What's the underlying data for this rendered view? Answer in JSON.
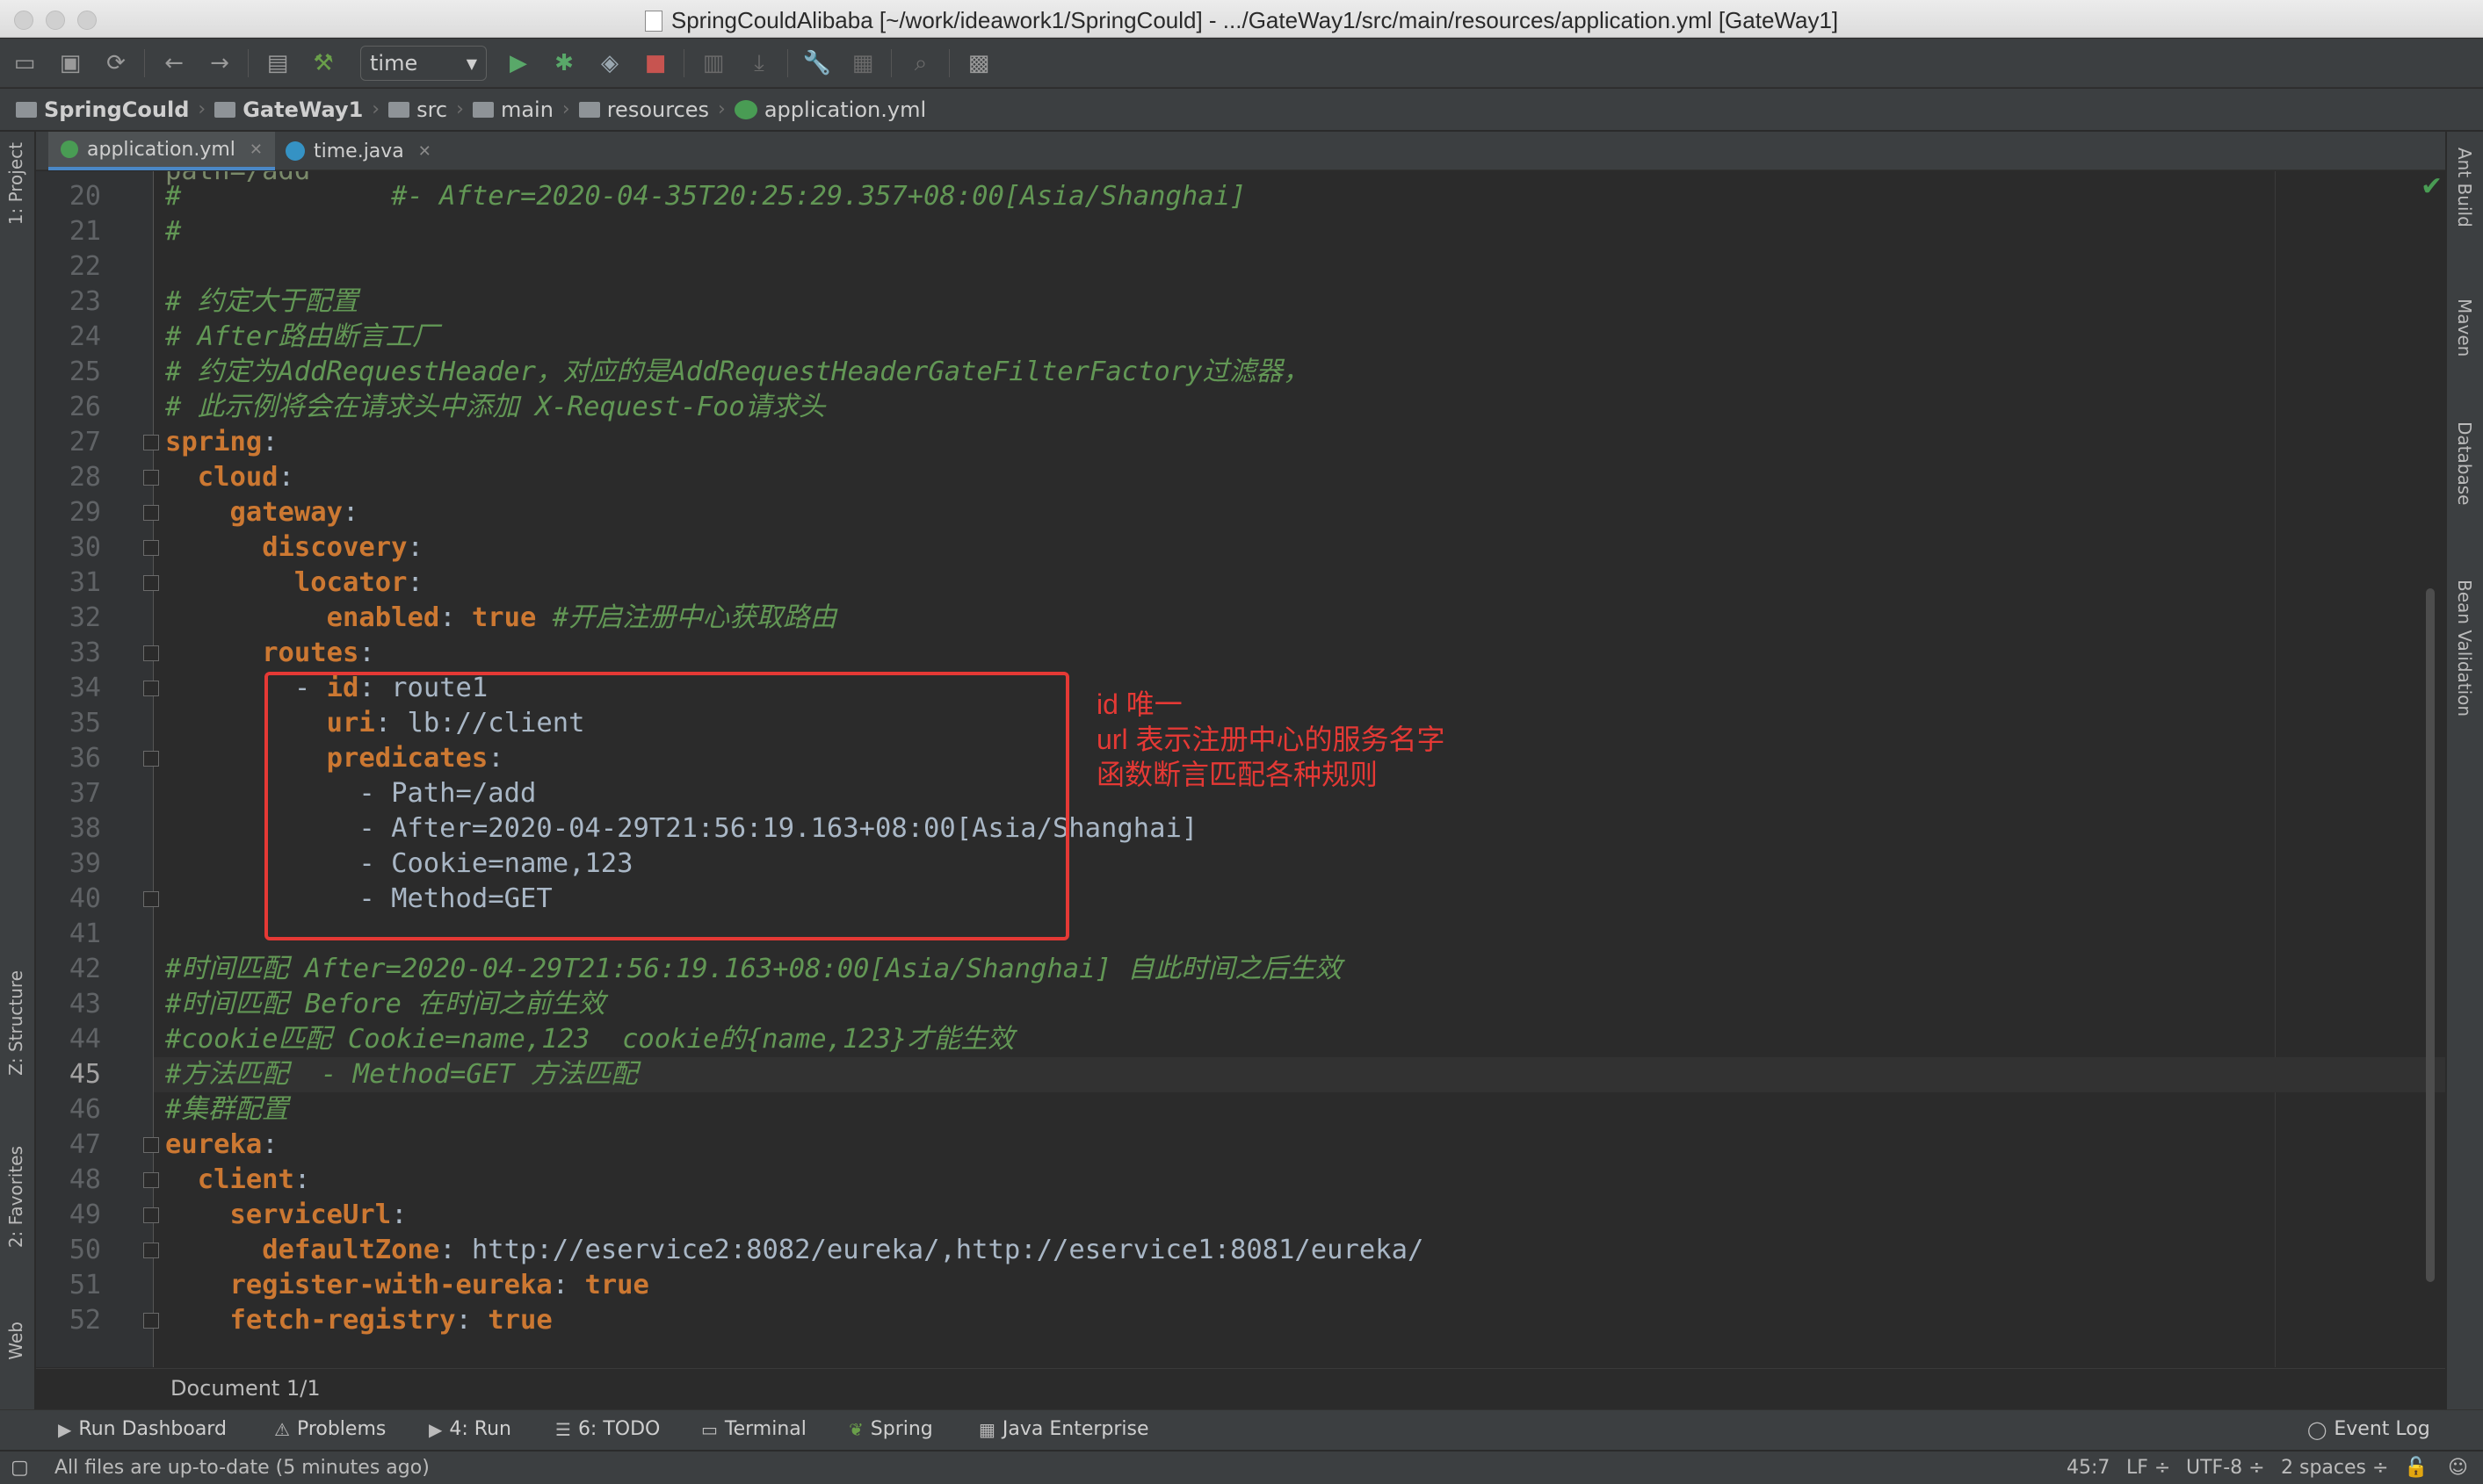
{
  "window": {
    "title": "SpringCouldAlibaba [~/work/ideawork1/SpringCould] - .../GateWay1/src/main/resources/application.yml [GateWay1]"
  },
  "toolbar": {
    "run_config": "time"
  },
  "breadcrumb": [
    "SpringCould",
    "GateWay1",
    "src",
    "main",
    "resources",
    "application.yml"
  ],
  "tabs": [
    {
      "label": "application.yml",
      "active": true
    },
    {
      "label": "time.java",
      "active": false
    }
  ],
  "left_tools": [
    "1: Project",
    "Z: Structure",
    "2: Favorites",
    "Web"
  ],
  "right_tools": [
    "Ant Build",
    "Maven",
    "Database",
    "Bean Validation"
  ],
  "partial_top_line": "path=/add",
  "editor_lines": [
    {
      "n": "20",
      "parts": [
        [
          "c",
          "#             #- After=2020-04-35T20:25:29.357+08:00[Asia/Shanghai]"
        ]
      ]
    },
    {
      "n": "21",
      "parts": [
        [
          "c",
          "#"
        ]
      ]
    },
    {
      "n": "22",
      "parts": []
    },
    {
      "n": "23",
      "parts": [
        [
          "c",
          "# 约定大于配置"
        ]
      ]
    },
    {
      "n": "24",
      "parts": [
        [
          "c",
          "# After路由断言工厂"
        ]
      ]
    },
    {
      "n": "25",
      "parts": [
        [
          "c",
          "# 约定为AddRequestHeader，对应的是AddRequestHeaderGateFilterFactory过滤器，"
        ]
      ]
    },
    {
      "n": "26",
      "parts": [
        [
          "c",
          "# 此示例将会在请求头中添加 X-Request-Foo请求头"
        ]
      ]
    },
    {
      "n": "27",
      "parts": [
        [
          "k",
          "spring"
        ],
        [
          "p",
          ":"
        ]
      ]
    },
    {
      "n": "28",
      "parts": [
        [
          "p",
          "  "
        ],
        [
          "k",
          "cloud"
        ],
        [
          "p",
          ":"
        ]
      ]
    },
    {
      "n": "29",
      "parts": [
        [
          "p",
          "    "
        ],
        [
          "k",
          "gateway"
        ],
        [
          "p",
          ":"
        ]
      ]
    },
    {
      "n": "30",
      "parts": [
        [
          "p",
          "      "
        ],
        [
          "k",
          "discovery"
        ],
        [
          "p",
          ":"
        ]
      ]
    },
    {
      "n": "31",
      "parts": [
        [
          "p",
          "        "
        ],
        [
          "k",
          "locator"
        ],
        [
          "p",
          ":"
        ]
      ]
    },
    {
      "n": "32",
      "parts": [
        [
          "p",
          "          "
        ],
        [
          "k",
          "enabled"
        ],
        [
          "p",
          ": "
        ],
        [
          "v",
          "true"
        ],
        [
          "p",
          " "
        ],
        [
          "c",
          "#开启注册中心获取路由"
        ]
      ]
    },
    {
      "n": "33",
      "parts": [
        [
          "p",
          "      "
        ],
        [
          "k",
          "routes"
        ],
        [
          "p",
          ":"
        ]
      ]
    },
    {
      "n": "34",
      "parts": [
        [
          "p",
          "        - "
        ],
        [
          "k",
          "id"
        ],
        [
          "p",
          ": route1"
        ]
      ]
    },
    {
      "n": "35",
      "parts": [
        [
          "p",
          "          "
        ],
        [
          "k",
          "uri"
        ],
        [
          "p",
          ": lb://client"
        ]
      ]
    },
    {
      "n": "36",
      "parts": [
        [
          "p",
          "          "
        ],
        [
          "k",
          "predicates"
        ],
        [
          "p",
          ":"
        ]
      ]
    },
    {
      "n": "37",
      "parts": [
        [
          "p",
          "            - Path=/add"
        ]
      ]
    },
    {
      "n": "38",
      "parts": [
        [
          "p",
          "            - After=2020-04-29T21:56:19.163+08:00[Asia/Shanghai]"
        ]
      ]
    },
    {
      "n": "39",
      "parts": [
        [
          "p",
          "            - Cookie=name,123"
        ]
      ]
    },
    {
      "n": "40",
      "parts": [
        [
          "p",
          "            - Method=GET"
        ]
      ]
    },
    {
      "n": "41",
      "parts": []
    },
    {
      "n": "42",
      "parts": [
        [
          "c",
          "#时间匹配 After=2020-04-29T21:56:19.163+08:00[Asia/Shanghai] 自此时间之后生效"
        ]
      ]
    },
    {
      "n": "43",
      "parts": [
        [
          "c",
          "#时间匹配 Before 在时间之前生效"
        ]
      ]
    },
    {
      "n": "44",
      "parts": [
        [
          "c",
          "#cookie匹配 Cookie=name,123  cookie的{name,123}才能生效"
        ]
      ]
    },
    {
      "n": "45",
      "parts": [
        [
          "c",
          "#方法匹配  - Method=GET 方法匹配"
        ]
      ]
    },
    {
      "n": "46",
      "parts": [
        [
          "c",
          "#集群配置"
        ]
      ]
    },
    {
      "n": "47",
      "parts": [
        [
          "k",
          "eureka"
        ],
        [
          "p",
          ":"
        ]
      ]
    },
    {
      "n": "48",
      "parts": [
        [
          "p",
          "  "
        ],
        [
          "k",
          "client"
        ],
        [
          "p",
          ":"
        ]
      ]
    },
    {
      "n": "49",
      "parts": [
        [
          "p",
          "    "
        ],
        [
          "k",
          "serviceUrl"
        ],
        [
          "p",
          ":"
        ]
      ]
    },
    {
      "n": "50",
      "parts": [
        [
          "p",
          "      "
        ],
        [
          "k",
          "defaultZone"
        ],
        [
          "p",
          ": http://eservice2:8082/eureka/,http://eservice1:8081/eureka/"
        ]
      ]
    },
    {
      "n": "51",
      "parts": [
        [
          "p",
          "    "
        ],
        [
          "k",
          "register-with-eureka"
        ],
        [
          "p",
          ": "
        ],
        [
          "v",
          "true"
        ]
      ]
    },
    {
      "n": "52",
      "parts": [
        [
          "p",
          "    "
        ],
        [
          "k",
          "fetch-registry"
        ],
        [
          "p",
          ": "
        ],
        [
          "v",
          "true"
        ]
      ]
    }
  ],
  "current_line": "45",
  "annotation": {
    "lines": [
      "id 唯一",
      "url 表示注册中心的服务名字",
      "函数断言匹配各种规则"
    ],
    "color": "#e53935"
  },
  "editor_breadcrumb": "Document 1/1",
  "tool_windows": [
    {
      "icon": "run-dashboard-icon",
      "label": "Run Dashboard"
    },
    {
      "icon": "problems-icon",
      "label": "Problems"
    },
    {
      "icon": "run-icon",
      "label": "4: Run"
    },
    {
      "icon": "todo-icon",
      "label": "6: TODO"
    },
    {
      "icon": "terminal-icon",
      "label": "Terminal"
    },
    {
      "icon": "spring-icon",
      "label": "Spring"
    },
    {
      "icon": "java-enterprise-icon",
      "label": "Java Enterprise"
    }
  ],
  "event_log": "Event Log",
  "status": {
    "message": "All files are up-to-date (5 minutes ago)",
    "position": "45:7",
    "line_sep": "LF ÷",
    "encoding": "UTF-8 ÷",
    "indent": "2 spaces ÷"
  }
}
